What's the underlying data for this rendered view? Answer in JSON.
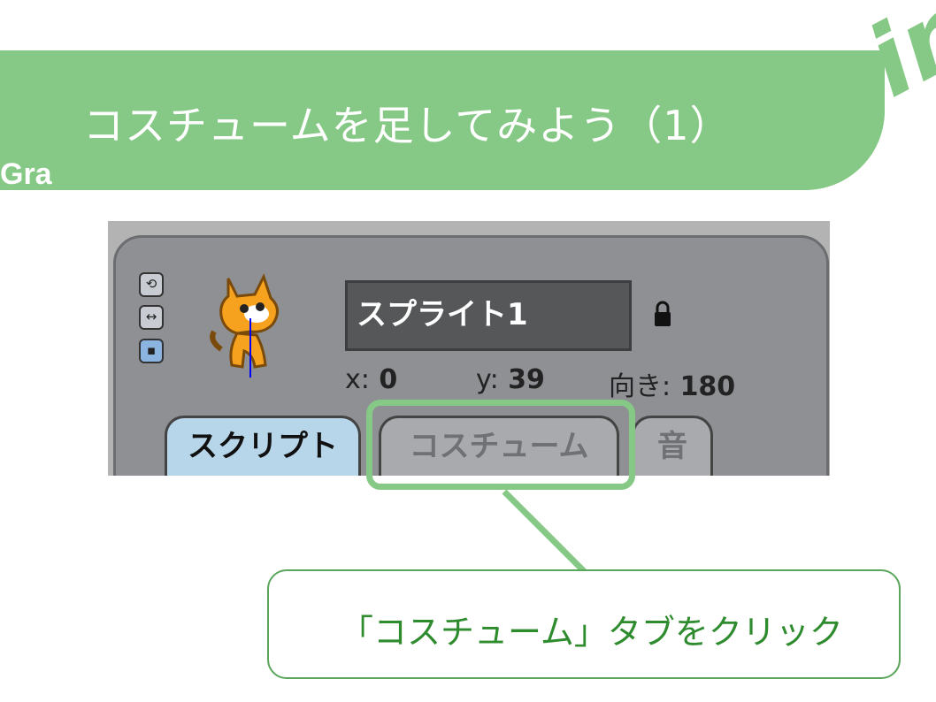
{
  "slide": {
    "title": "コスチュームを足してみよう（1）",
    "corner_label": "Gra",
    "logo_text": "min"
  },
  "sprite_panel": {
    "sprite_name": "スプライト1",
    "x_label": "x:",
    "x_value": "0",
    "y_label": "y:",
    "y_value": "39",
    "direction_label": "向き:",
    "direction_value": "180",
    "rotation_tools": [
      "rotate-icon",
      "flip-horizontal-icon",
      "no-rotate-icon"
    ],
    "tabs": [
      {
        "label": "スクリプト",
        "selected": true
      },
      {
        "label": "コスチューム",
        "selected": false
      },
      {
        "label": "音",
        "selected": false
      }
    ]
  },
  "callout": {
    "text": "「コスチューム」タブをクリック"
  },
  "colors": {
    "accent_green": "#86c986",
    "callout_text": "#2e8b2e",
    "panel_gray": "#8e9093",
    "selected_tab": "#b8d6ea"
  }
}
